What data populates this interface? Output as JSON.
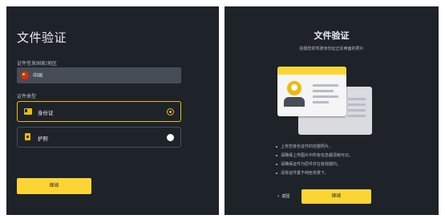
{
  "left": {
    "title": "文件验证",
    "country_label": "证件签发国家/地区",
    "country_value": "中国",
    "doc_type_label": "证件类型",
    "options": [
      {
        "label": "身份证",
        "selected": true,
        "icon": "id-card-icon"
      },
      {
        "label": "护照",
        "selected": false,
        "icon": "passport-icon"
      }
    ],
    "continue_label": "继续"
  },
  "right": {
    "title": "文件验证",
    "subtitle": "拍摄您的驾驶身份证正反两面的照片",
    "tips": [
      "上传您身份证件的完整照片。",
      "请确保上传图片中所有信息都清晰可识。",
      "请确保证件为原件并在有效期内。",
      "请将证件置于纯色背景下。"
    ],
    "back_label": "返回",
    "continue_label": "继续"
  },
  "colors": {
    "background": "#1e2329",
    "accent": "#fcd535",
    "field": "#474d57"
  }
}
